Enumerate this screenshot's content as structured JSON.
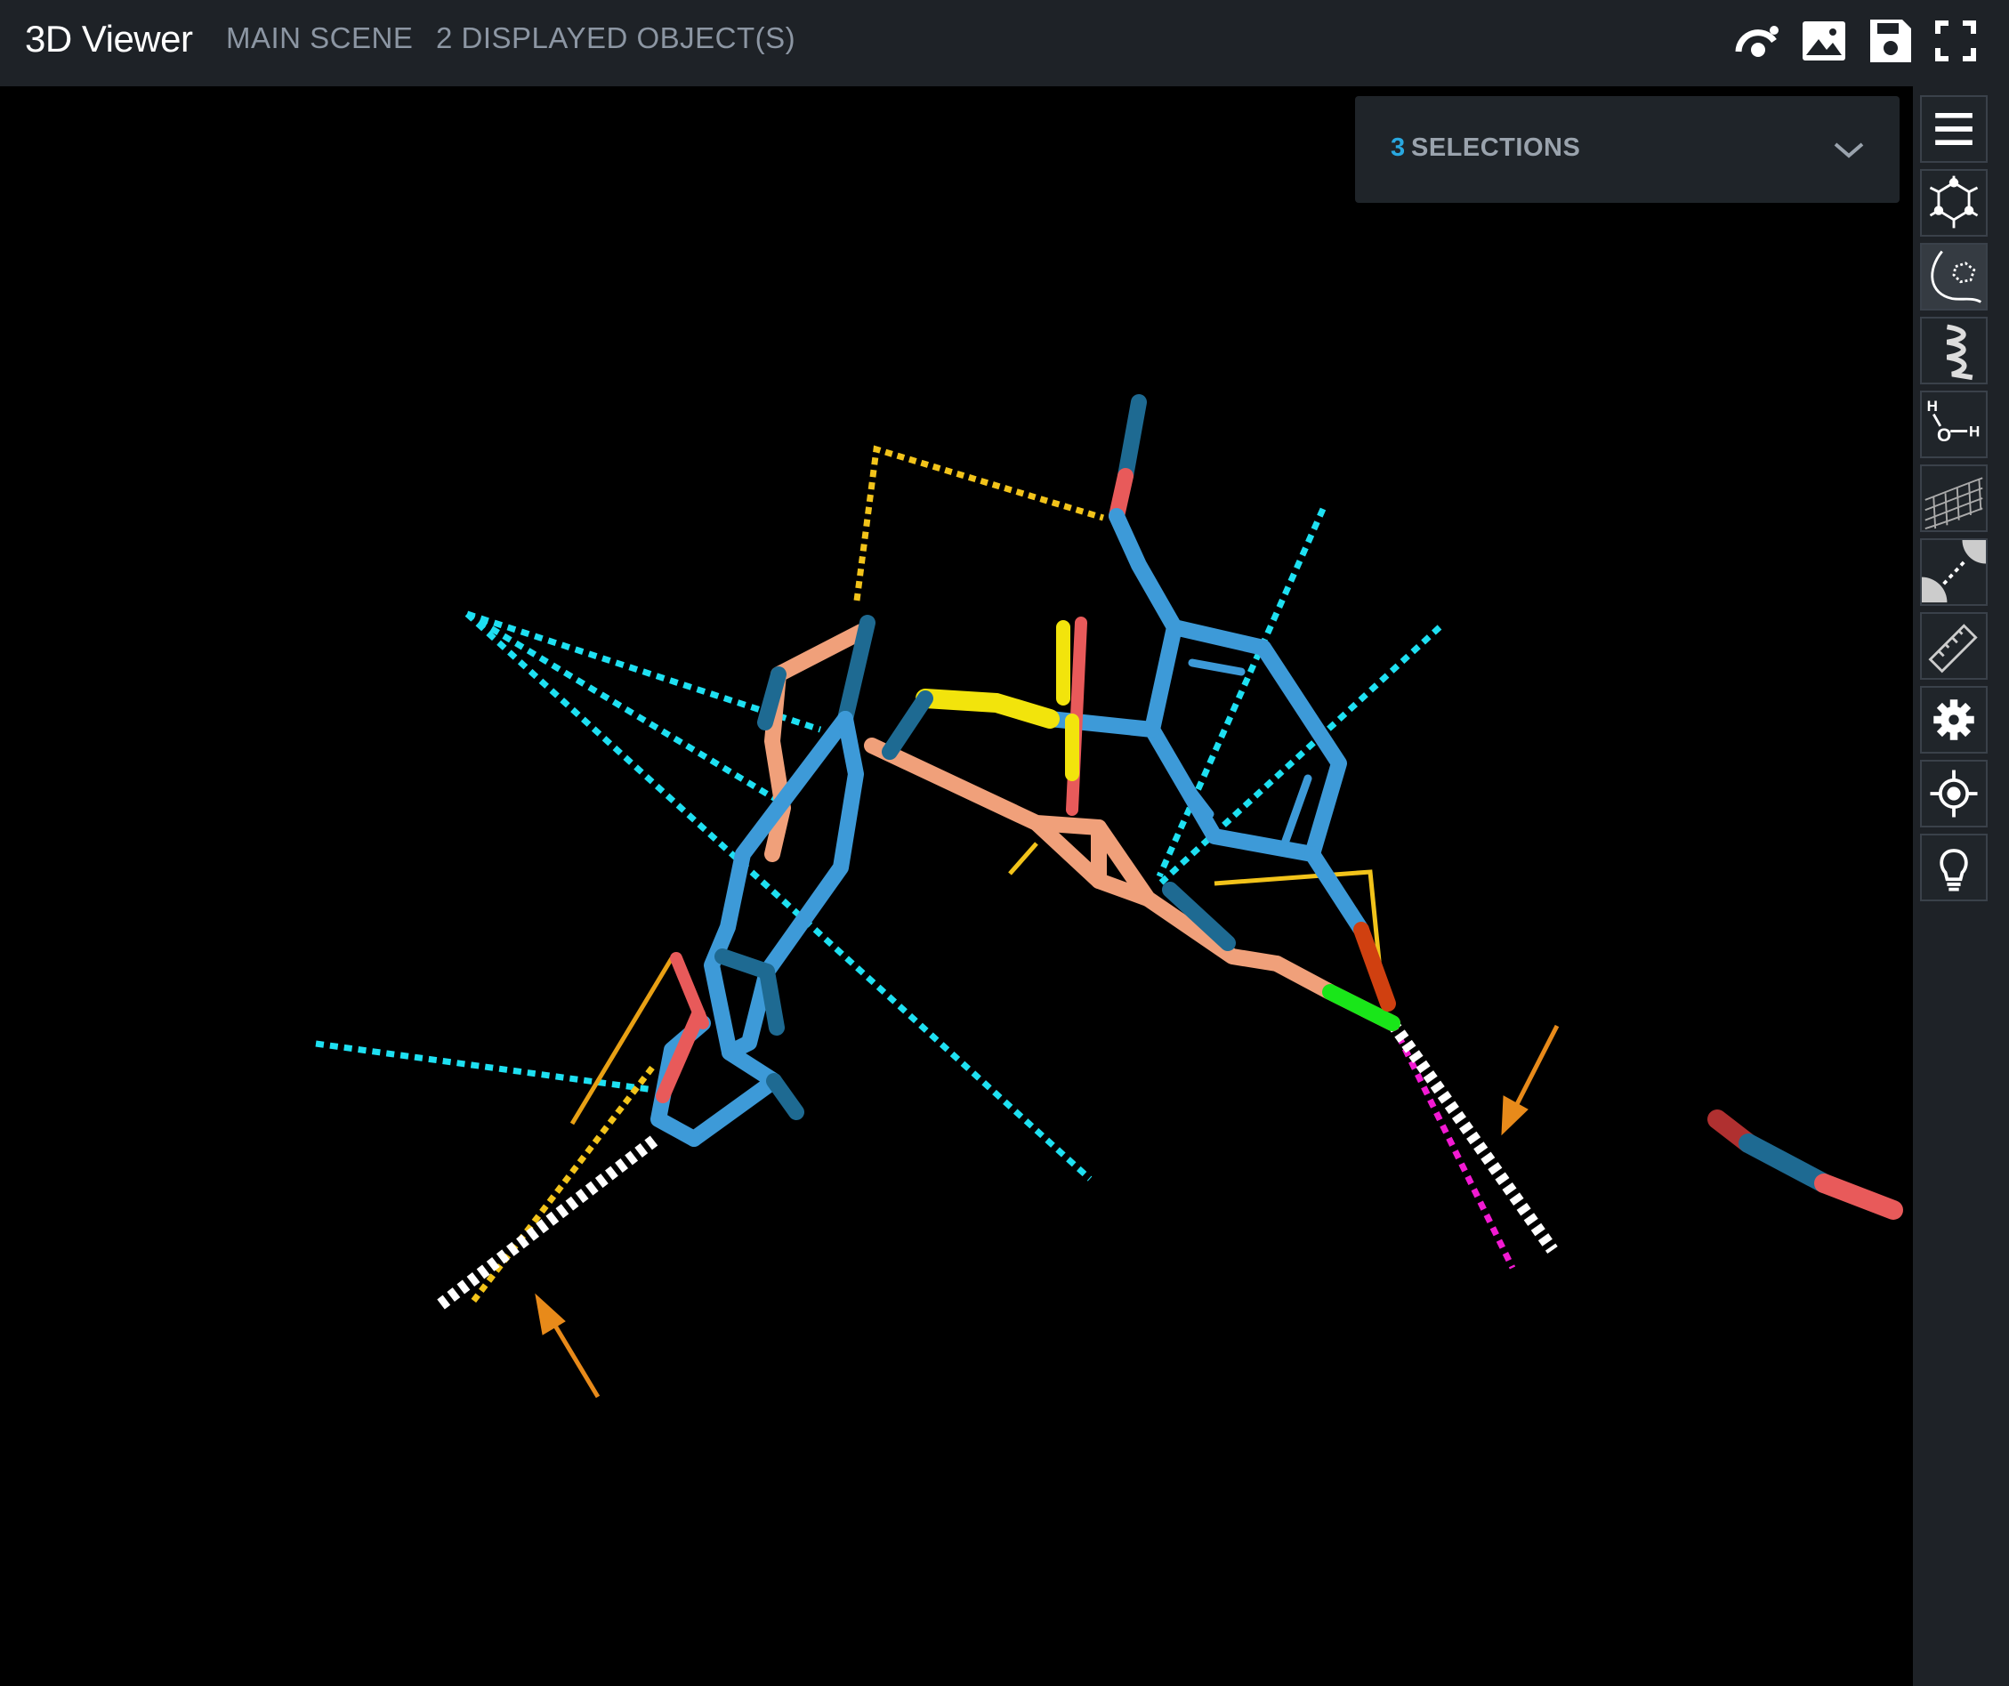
{
  "header": {
    "title": "3D Viewer",
    "scene_label": "MAIN SCENE",
    "objects_label": "2 DISPLAYED OBJECT(S)",
    "icons": [
      "rotate-view-icon",
      "snapshot-image-icon",
      "save-icon",
      "fullscreen-icon"
    ]
  },
  "selections": {
    "count": "3",
    "label": "SELECTIONS"
  },
  "toolbar": {
    "items": [
      {
        "name": "menu-icon"
      },
      {
        "name": "molecule-icon"
      },
      {
        "name": "ligand-pocket-icon",
        "active": true
      },
      {
        "name": "helix-icon"
      },
      {
        "name": "water-icon",
        "label_h": "H",
        "label_o": "O",
        "label_h2": "H"
      },
      {
        "name": "surface-mesh-icon"
      },
      {
        "name": "interaction-icon"
      },
      {
        "name": "ruler-icon"
      },
      {
        "name": "settings-gear-icon"
      },
      {
        "name": "center-target-icon"
      },
      {
        "name": "light-bulb-icon"
      }
    ]
  },
  "colors": {
    "carbon_blue": "#3d9ad8",
    "carbon_dark": "#1e6a92",
    "carbon_salmon": "#f0a07a",
    "oxygen": "#e85a5a",
    "sulfur": "#f2e40c",
    "chlorine": "#19e619",
    "hbond_yellow": "#f2c31a",
    "interaction_cyan": "#1ee0f2",
    "halogen_magenta": "#f21ad2",
    "arrow_orange": "#e88a1a"
  }
}
